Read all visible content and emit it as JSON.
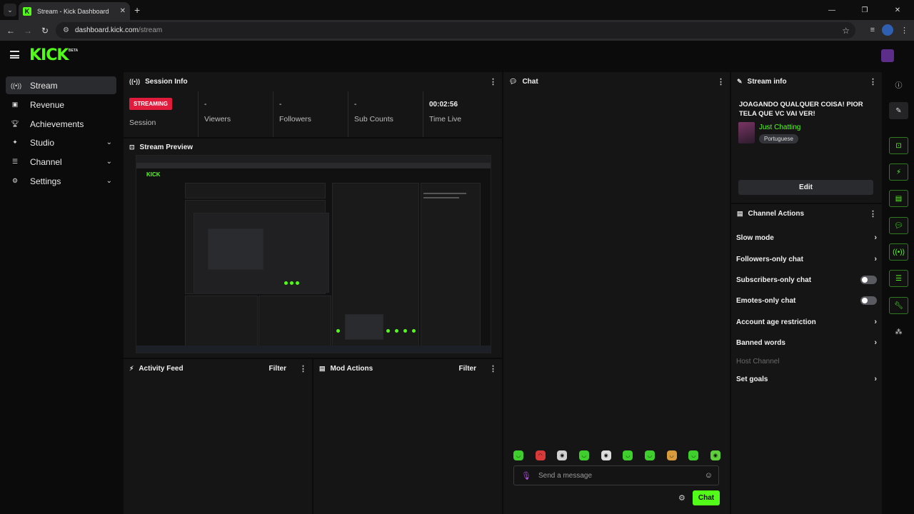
{
  "browser": {
    "tab_title": "Stream - Kick Dashboard",
    "favicon_letter": "K",
    "url_host": "dashboard.kick.com",
    "url_path": "/stream"
  },
  "app": {
    "logo": "KICK",
    "beta": "BETA"
  },
  "sidebar": {
    "items": [
      {
        "label": "Stream",
        "icon": "broadcast-icon"
      },
      {
        "label": "Revenue",
        "icon": "dollar-icon"
      },
      {
        "label": "Achievements",
        "icon": "trophy-icon"
      },
      {
        "label": "Studio",
        "icon": "studio-icon"
      },
      {
        "label": "Channel",
        "icon": "channel-icon"
      },
      {
        "label": "Settings",
        "icon": "gear-icon"
      }
    ]
  },
  "session": {
    "title": "Session Info",
    "badge": "STREAMING",
    "session_label": "Session",
    "viewers_value": "-",
    "viewers_label": "Viewers",
    "followers_value": "-",
    "followers_label": "Followers",
    "subs_value": "-",
    "subs_label": "Sub Counts",
    "time_value": "00:02:56",
    "time_label": "Time Live"
  },
  "preview": {
    "title": "Stream Preview",
    "inner_logo": "KICK"
  },
  "activity": {
    "title": "Activity Feed",
    "filter": "Filter"
  },
  "mod": {
    "title": "Mod Actions",
    "filter": "Filter"
  },
  "chat": {
    "title": "Chat",
    "placeholder": "Send a message",
    "send_label": "Chat"
  },
  "stream_info": {
    "title": "Stream info",
    "stream_title": "JOAGANDO QUALQUER COISA! PIOR TELA QUE VC VAI VER!",
    "category": "Just Chatting",
    "language": "Portuguese",
    "edit_label": "Edit"
  },
  "channel_actions": {
    "title": "Channel Actions",
    "rows": [
      {
        "label": "Slow mode",
        "kind": "arrow"
      },
      {
        "label": "Followers-only chat",
        "kind": "arrow"
      },
      {
        "label": "Subscribers-only chat",
        "kind": "toggle",
        "on": false
      },
      {
        "label": "Emotes-only chat",
        "kind": "toggle",
        "on": false
      },
      {
        "label": "Account age restriction",
        "kind": "arrow"
      },
      {
        "label": "Banned words",
        "kind": "arrow"
      },
      {
        "label": "Host Channel",
        "kind": "disabled"
      },
      {
        "label": "Set goals",
        "kind": "arrow"
      }
    ]
  },
  "colors": {
    "accent": "#53fc18",
    "streaming": "#e01b3c",
    "panel": "#151516"
  }
}
